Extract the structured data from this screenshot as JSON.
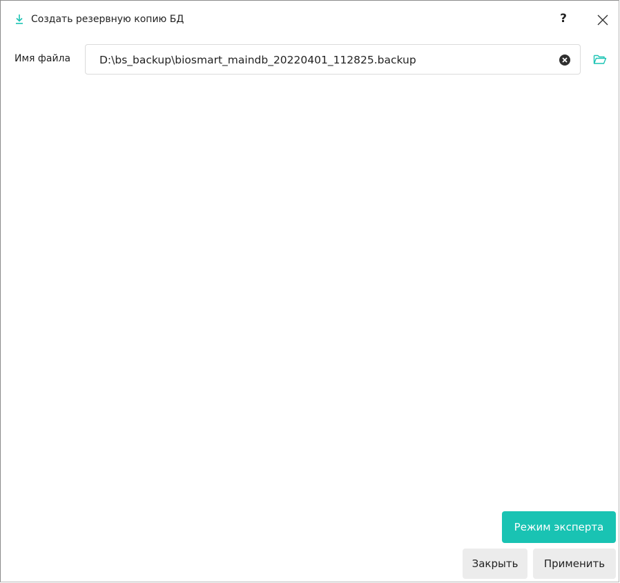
{
  "dialog": {
    "title": "Создать резервную копию БД",
    "help_label": "?",
    "icon": "download-icon",
    "accent_color": "#19c3b3"
  },
  "form": {
    "file_label": "Имя файла",
    "file_value": "D:\\bs_backup\\biosmart_maindb_20220401_112825.backup",
    "clear_icon": "clear-circle-icon",
    "browse_icon": "folder-open-icon"
  },
  "buttons": {
    "expert_label": "Режим эксперта",
    "close_label": "Закрыть",
    "apply_label": "Применить"
  }
}
